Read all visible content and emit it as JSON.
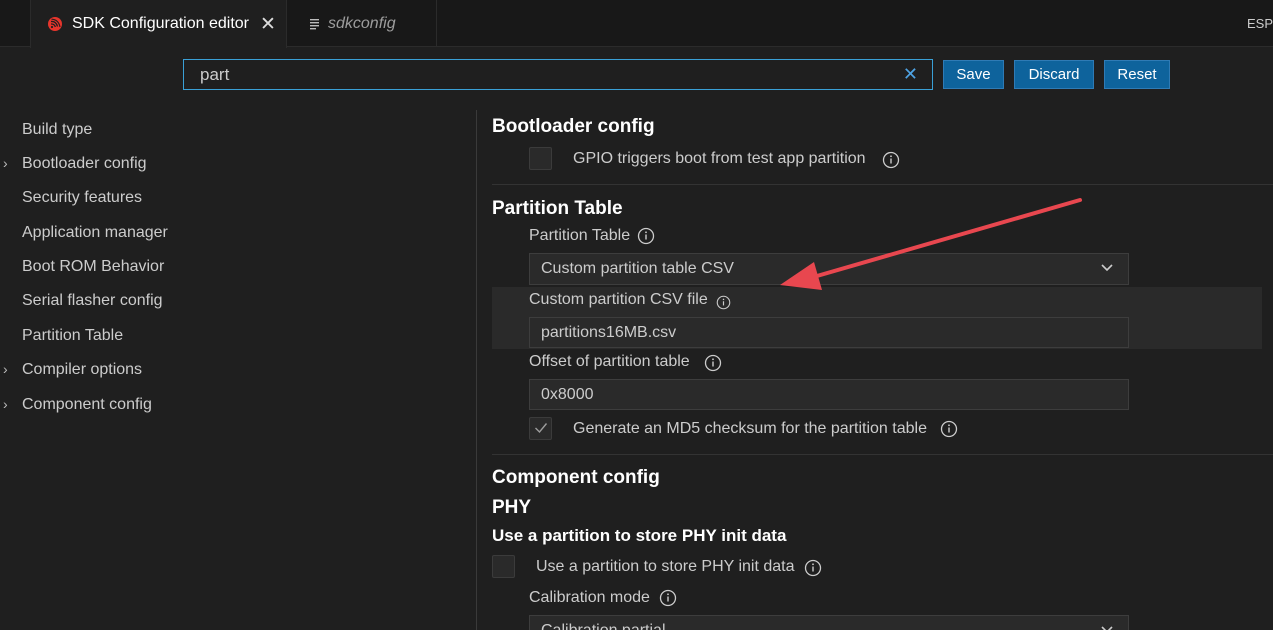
{
  "tabs": {
    "active": {
      "label": "SDK Configuration editor",
      "icon": "espressif-icon"
    },
    "inactive": {
      "label": "sdkconfig",
      "icon": "file-lines-icon"
    },
    "right_label": "ESP"
  },
  "search": {
    "value": "part",
    "placeholder": ""
  },
  "toolbar": {
    "save_label": "Save",
    "discard_label": "Discard",
    "reset_label": "Reset"
  },
  "sidebar": {
    "items": [
      {
        "label": "Build type",
        "expandable": false
      },
      {
        "label": "Bootloader config",
        "expandable": true
      },
      {
        "label": "Security features",
        "expandable": false
      },
      {
        "label": "Application manager",
        "expandable": false
      },
      {
        "label": "Boot ROM Behavior",
        "expandable": false
      },
      {
        "label": "Serial flasher config",
        "expandable": false
      },
      {
        "label": "Partition Table",
        "expandable": false
      },
      {
        "label": "Compiler options",
        "expandable": true
      },
      {
        "label": "Component config",
        "expandable": true
      }
    ]
  },
  "content": {
    "bootloader": {
      "title": "Bootloader config",
      "gpio_option_label": "GPIO triggers boot from test app partition",
      "gpio_option_checked": false
    },
    "partition_table": {
      "title": "Partition Table",
      "type_label": "Partition Table",
      "type_value": "Custom partition table CSV",
      "csv_label": "Custom partition CSV file",
      "csv_value": "partitions16MB.csv",
      "offset_label": "Offset of partition table",
      "offset_value": "0x8000",
      "md5_label": "Generate an MD5 checksum for the partition table",
      "md5_checked": true
    },
    "component": {
      "title": "Component config",
      "phy_title": "PHY",
      "phy_sub_title": "Use a partition to store PHY init data",
      "phy_option_label": "Use a partition to store PHY init data",
      "phy_option_checked": false,
      "calibration_label": "Calibration mode",
      "calibration_value": "Calibration partial"
    }
  },
  "colors": {
    "accent": "#0e639c",
    "focus_border": "#3aa0d6",
    "annotation_arrow": "#e8474f",
    "background": "#1f1f1f"
  }
}
